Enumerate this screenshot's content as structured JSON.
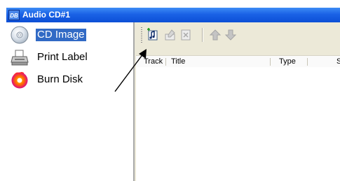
{
  "window": {
    "title": "Audio CD#1",
    "app_icon_text": "DB"
  },
  "sidebar": {
    "items": [
      {
        "label": "CD Image",
        "icon": "cd-icon",
        "selected": true
      },
      {
        "label": "Print Label",
        "icon": "printer-icon",
        "selected": false
      },
      {
        "label": "Burn Disk",
        "icon": "burn-disc-icon",
        "selected": false
      }
    ]
  },
  "toolbar": {
    "buttons": [
      {
        "icon": "add-track-icon",
        "enabled": true
      },
      {
        "icon": "edit-track-icon",
        "enabled": false
      },
      {
        "icon": "delete-track-icon",
        "enabled": false
      },
      {
        "icon": "move-up-icon",
        "enabled": false
      },
      {
        "icon": "move-down-icon",
        "enabled": false
      }
    ]
  },
  "track_list": {
    "columns": [
      "Track",
      "Title",
      "Type",
      "S"
    ]
  },
  "colors": {
    "title_bar": "#0c4fd6",
    "selection": "#316ac5"
  }
}
